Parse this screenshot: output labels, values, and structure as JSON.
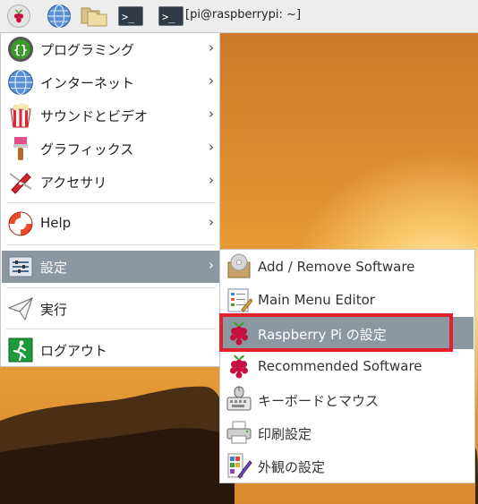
{
  "taskbar": {
    "window_title": "[pi@raspberrypi: ~]",
    "icons": [
      "raspberry-menu-icon",
      "web-browser-icon",
      "file-manager-icon",
      "terminal-icon"
    ]
  },
  "menu": {
    "items": [
      {
        "label": "プログラミング",
        "icon": "programming-icon",
        "has_submenu": true
      },
      {
        "label": "インターネット",
        "icon": "internet-icon",
        "has_submenu": true
      },
      {
        "label": "サウンドとビデオ",
        "icon": "sound-video-icon",
        "has_submenu": true
      },
      {
        "label": "グラフィックス",
        "icon": "graphics-icon",
        "has_submenu": true
      },
      {
        "label": "アクセサリ",
        "icon": "accessories-icon",
        "has_submenu": true
      },
      {
        "label": "Help",
        "icon": "help-icon",
        "has_submenu": true
      },
      {
        "label": "設定",
        "icon": "settings-icon",
        "has_submenu": true,
        "active": true
      },
      {
        "label": "実行",
        "icon": "run-icon",
        "has_submenu": false
      },
      {
        "label": "ログアウト",
        "icon": "logout-icon",
        "has_submenu": false
      }
    ],
    "arrow": "›"
  },
  "submenu": {
    "items": [
      {
        "label": "Add / Remove Software",
        "icon": "add-remove-software-icon"
      },
      {
        "label": "Main Menu Editor",
        "icon": "main-menu-editor-icon"
      },
      {
        "label": "Raspberry Pi の設定",
        "icon": "raspberry-config-icon",
        "active": true
      },
      {
        "label": "Recommended Software",
        "icon": "recommended-software-icon"
      },
      {
        "label": "キーボードとマウス",
        "icon": "keyboard-mouse-icon"
      },
      {
        "label": "印刷設定",
        "icon": "printer-icon"
      },
      {
        "label": "外観の設定",
        "icon": "appearance-icon"
      }
    ]
  },
  "colors": {
    "highlight": "#8c98a1",
    "annotation_box": "#e0202a"
  }
}
